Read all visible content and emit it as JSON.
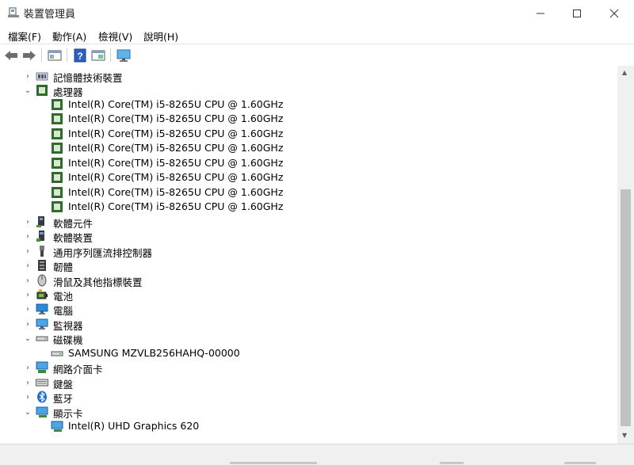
{
  "window": {
    "title": "裝置管理員",
    "minimize_label": "—",
    "maximize_label": "☐",
    "close_label": "✕"
  },
  "menu": [
    {
      "label": "檔案(F)"
    },
    {
      "label": "動作(A)"
    },
    {
      "label": "檢視(V)"
    },
    {
      "label": "說明(H)"
    }
  ],
  "toolbar": {
    "icons": [
      "back-icon",
      "forward-icon",
      "properties-icon",
      "help-icon",
      "view-icon",
      "monitor-icon"
    ]
  },
  "tree": {
    "nodes": [
      {
        "label": "記憶體技術裝置",
        "expanded": false,
        "level": 0,
        "icon": "memory-device-icon"
      },
      {
        "label": "處理器",
        "expanded": true,
        "level": 0,
        "icon": "processor-icon"
      },
      {
        "label": "Intel(R) Core(TM) i5-8265U CPU @ 1.60GHz",
        "level": 1,
        "icon": "processor-icon"
      },
      {
        "label": "Intel(R) Core(TM) i5-8265U CPU @ 1.60GHz",
        "level": 1,
        "icon": "processor-icon"
      },
      {
        "label": "Intel(R) Core(TM) i5-8265U CPU @ 1.60GHz",
        "level": 1,
        "icon": "processor-icon"
      },
      {
        "label": "Intel(R) Core(TM) i5-8265U CPU @ 1.60GHz",
        "level": 1,
        "icon": "processor-icon"
      },
      {
        "label": "Intel(R) Core(TM) i5-8265U CPU @ 1.60GHz",
        "level": 1,
        "icon": "processor-icon"
      },
      {
        "label": "Intel(R) Core(TM) i5-8265U CPU @ 1.60GHz",
        "level": 1,
        "icon": "processor-icon"
      },
      {
        "label": "Intel(R) Core(TM) i5-8265U CPU @ 1.60GHz",
        "level": 1,
        "icon": "processor-icon"
      },
      {
        "label": "Intel(R) Core(TM) i5-8265U CPU @ 1.60GHz",
        "level": 1,
        "icon": "processor-icon"
      },
      {
        "label": "軟體元件",
        "expanded": false,
        "level": 0,
        "icon": "software-component-icon"
      },
      {
        "label": "軟體裝置",
        "expanded": false,
        "level": 0,
        "icon": "software-device-icon"
      },
      {
        "label": "通用序列匯流排控制器",
        "expanded": false,
        "level": 0,
        "icon": "usb-icon"
      },
      {
        "label": "韌體",
        "expanded": false,
        "level": 0,
        "icon": "firmware-icon"
      },
      {
        "label": "滑鼠及其他指標裝置",
        "expanded": false,
        "level": 0,
        "icon": "mouse-icon"
      },
      {
        "label": "電池",
        "expanded": false,
        "level": 0,
        "icon": "battery-icon"
      },
      {
        "label": "電腦",
        "expanded": false,
        "level": 0,
        "icon": "computer-icon"
      },
      {
        "label": "監視器",
        "expanded": false,
        "level": 0,
        "icon": "monitor-icon"
      },
      {
        "label": "磁碟機",
        "expanded": true,
        "level": 0,
        "icon": "disk-drive-icon"
      },
      {
        "label": "SAMSUNG MZVLB256HAHQ-00000",
        "level": 1,
        "icon": "disk-drive-icon"
      },
      {
        "label": "網路介面卡",
        "expanded": false,
        "level": 0,
        "icon": "network-adapter-icon"
      },
      {
        "label": "鍵盤",
        "expanded": false,
        "level": 0,
        "icon": "keyboard-icon"
      },
      {
        "label": "藍牙",
        "expanded": false,
        "level": 0,
        "icon": "bluetooth-icon"
      },
      {
        "label": "顯示卡",
        "expanded": true,
        "level": 0,
        "icon": "display-adapter-icon"
      },
      {
        "label": "Intel(R) UHD Graphics 620",
        "level": 1,
        "icon": "display-adapter-icon"
      }
    ]
  },
  "colors": {
    "processor_green": "#2f6b2a",
    "monitor_blue": "#2a8bd6",
    "bluetooth_blue": "#1e6fd0",
    "scroll_thumb": "#c2c2c2"
  }
}
